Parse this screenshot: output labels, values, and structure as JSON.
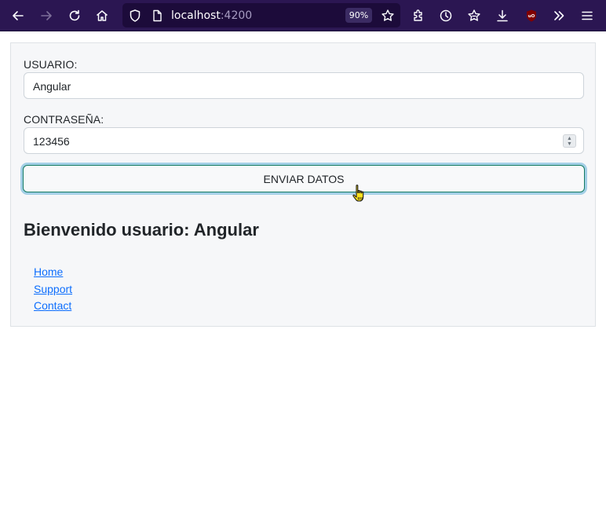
{
  "browser": {
    "url_host": "localhost",
    "url_port": ":4200",
    "zoom": "90%",
    "icons": {
      "back": "back-arrow-icon",
      "forward": "forward-arrow-icon",
      "reload": "reload-icon",
      "home": "home-icon",
      "shield": "tracking-protection-shield-icon",
      "page": "page-info-icon",
      "bookmark": "bookmark-star-icon",
      "extensions": "extensions-puzzle-icon",
      "history": "history-clock-icon",
      "reading_list": "reading-list-star-icon",
      "downloads": "download-arrow-icon",
      "ublock": "ublock-origin-icon",
      "overflow": "overflow-chevrons-icon",
      "menu": "hamburger-menu-icon"
    },
    "colors": {
      "toolbar": "#2b1652",
      "urlbar": "#1c0b3a"
    }
  },
  "form": {
    "user_label": "USUARIO:",
    "user_value": "Angular",
    "password_label": "CONTRASEÑA:",
    "password_value": "123456",
    "submit_label": "ENVIAR DATOS"
  },
  "welcome_text": "Bienvenido usuario: Angular",
  "nav": {
    "home": "Home",
    "support": "Support",
    "contact": "Contact"
  },
  "colors": {
    "link": "#0d6efd",
    "button_border": "#127a62",
    "focus_ring": "#a3cfe6"
  }
}
